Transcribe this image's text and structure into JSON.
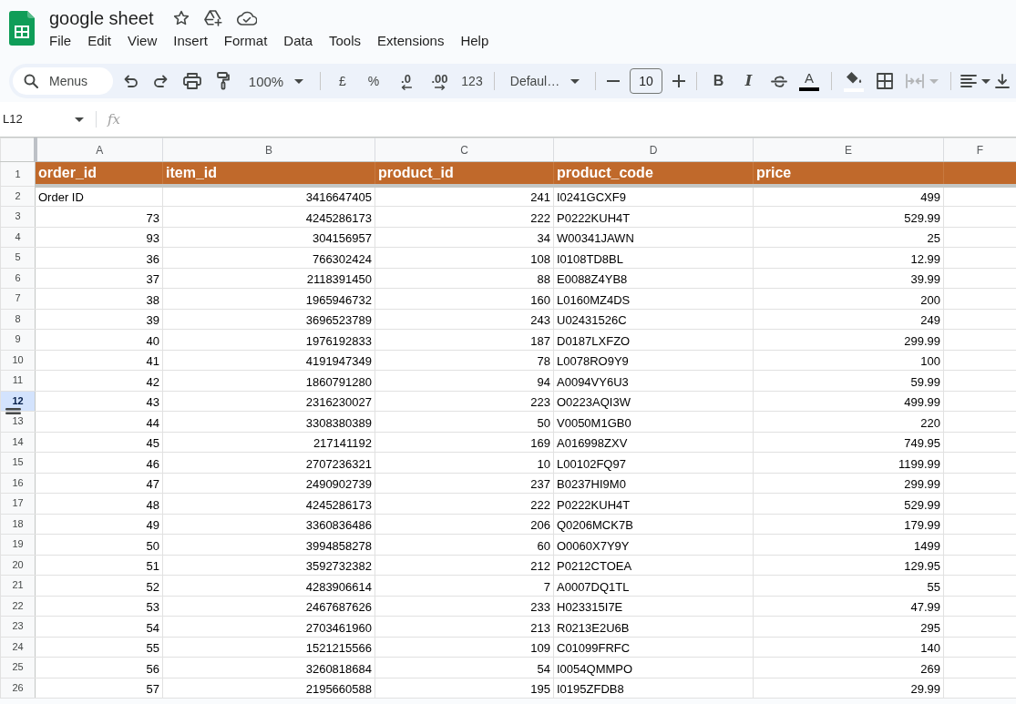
{
  "document": {
    "title": "google sheet"
  },
  "menu": [
    "File",
    "Edit",
    "View",
    "Insert",
    "Format",
    "Data",
    "Tools",
    "Extensions",
    "Help"
  ],
  "toolbar": {
    "search": {
      "label": "Menus"
    },
    "zoom": "100%",
    "number_formats": [
      {
        "label": "£",
        "kind": "plain"
      },
      {
        "label": "%",
        "kind": "plain"
      },
      {
        "label": ".0",
        "kind": "decrease_decimal"
      },
      {
        "label": ".00",
        "kind": "increase_decimal"
      },
      {
        "label": "123",
        "kind": "plain"
      }
    ],
    "font": "Defaul…",
    "font_size": "10",
    "text_styles": [
      {
        "label": "B",
        "kind": "bold"
      },
      {
        "label": "I",
        "kind": "italic"
      }
    ],
    "text_color": {
      "label": "A",
      "color": "#000000"
    },
    "fill_color": {
      "color": "#ffffff"
    },
    "merge": {
      "disabled": true
    }
  },
  "formula_bar": {
    "name_box": "L12",
    "function_label": "fx"
  },
  "sheet": {
    "columns": [
      {
        "letter": "A",
        "kind": "number"
      },
      {
        "letter": "B",
        "kind": "number"
      },
      {
        "letter": "C",
        "kind": "number"
      },
      {
        "letter": "D",
        "kind": "text"
      },
      {
        "letter": "E",
        "kind": "number"
      },
      {
        "letter": "F"
      }
    ],
    "header_row": {
      "number": "1",
      "selected": false,
      "cells": [
        "order_id",
        "item_id",
        "product_id",
        "product_code",
        "price"
      ]
    },
    "rows": [
      {
        "number": "2",
        "selected": false,
        "cells": [
          {
            "value": "Order ID",
            "kind": "text"
          },
          "3416647405",
          "241",
          "I0241GCXF9",
          "499"
        ]
      },
      {
        "number": "3",
        "selected": false,
        "cells": [
          "73",
          "4245286173",
          "222",
          "P0222KUH4T",
          "529.99"
        ]
      },
      {
        "number": "4",
        "selected": false,
        "cells": [
          "93",
          "304156957",
          "34",
          "W00341JAWN",
          "25"
        ]
      },
      {
        "number": "5",
        "selected": false,
        "cells": [
          "36",
          "766302424",
          "108",
          "I0108TD8BL",
          "12.99"
        ]
      },
      {
        "number": "6",
        "selected": false,
        "cells": [
          "37",
          "2118391450",
          "88",
          "E0088Z4YB8",
          "39.99"
        ]
      },
      {
        "number": "7",
        "selected": false,
        "cells": [
          "38",
          "1965946732",
          "160",
          "L0160MZ4DS",
          "200"
        ]
      },
      {
        "number": "8",
        "selected": false,
        "cells": [
          "39",
          "3696523789",
          "243",
          "U02431526C",
          "249"
        ]
      },
      {
        "number": "9",
        "selected": false,
        "cells": [
          "40",
          "1976192833",
          "187",
          "D0187LXFZO",
          "299.99"
        ]
      },
      {
        "number": "10",
        "selected": false,
        "cells": [
          "41",
          "4191947349",
          "78",
          "L0078RO9Y9",
          "100"
        ]
      },
      {
        "number": "11",
        "selected": false,
        "cells": [
          "42",
          "1860791280",
          "94",
          "A0094VY6U3",
          "59.99"
        ]
      },
      {
        "number": "12",
        "selected": true,
        "cells": [
          "43",
          "2316230027",
          "223",
          "O0223AQI3W",
          "499.99"
        ]
      },
      {
        "number": "13",
        "selected": false,
        "cells": [
          "44",
          "3308380389",
          "50",
          "V0050M1GB0",
          "220"
        ]
      },
      {
        "number": "14",
        "selected": false,
        "cells": [
          "45",
          "217141192",
          "169",
          "A016998ZXV",
          "749.95"
        ]
      },
      {
        "number": "15",
        "selected": false,
        "cells": [
          "46",
          "2707236321",
          "10",
          "L00102FQ97",
          "1199.99"
        ]
      },
      {
        "number": "16",
        "selected": false,
        "cells": [
          "47",
          "2490902739",
          "237",
          "B0237HI9M0",
          "299.99"
        ]
      },
      {
        "number": "17",
        "selected": false,
        "cells": [
          "48",
          "4245286173",
          "222",
          "P0222KUH4T",
          "529.99"
        ]
      },
      {
        "number": "18",
        "selected": false,
        "cells": [
          "49",
          "3360836486",
          "206",
          "Q0206MCK7B",
          "179.99"
        ]
      },
      {
        "number": "19",
        "selected": false,
        "cells": [
          "50",
          "3994858278",
          "60",
          "O0060X7Y9Y",
          "1499"
        ]
      },
      {
        "number": "20",
        "selected": false,
        "cells": [
          "51",
          "3592732382",
          "212",
          "P0212CTOEA",
          "129.95"
        ]
      },
      {
        "number": "21",
        "selected": false,
        "cells": [
          "52",
          "4283906614",
          "7",
          "A0007DQ1TL",
          "55"
        ]
      },
      {
        "number": "22",
        "selected": false,
        "cells": [
          "53",
          "2467687626",
          "233",
          "H023315I7E",
          "47.99"
        ]
      },
      {
        "number": "23",
        "selected": false,
        "cells": [
          "54",
          "2703461960",
          "213",
          "R0213E2U6B",
          "295"
        ]
      },
      {
        "number": "24",
        "selected": false,
        "cells": [
          "55",
          "1521215566",
          "109",
          "C01099FRFC",
          "140"
        ]
      },
      {
        "number": "25",
        "selected": false,
        "cells": [
          "56",
          "3260818684",
          "54",
          "I0054QMMPO",
          "269"
        ]
      },
      {
        "number": "26",
        "selected": false,
        "cells": [
          "57",
          "2195660588",
          "195",
          "I0195ZFDB8",
          "29.99"
        ]
      }
    ]
  }
}
